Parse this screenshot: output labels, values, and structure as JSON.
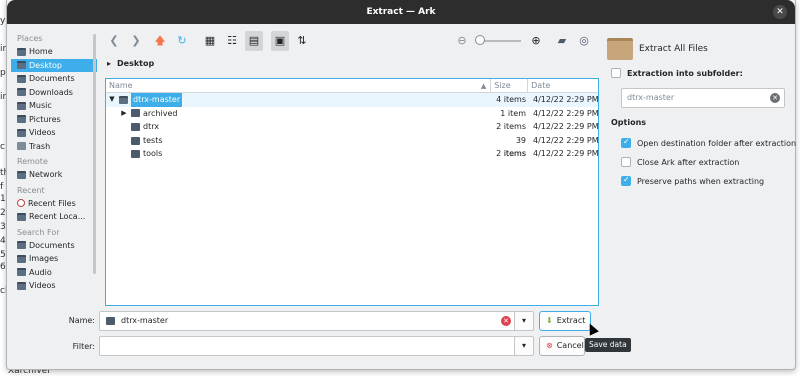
{
  "window": {
    "title": "Extract — Ark"
  },
  "underlying": {
    "left_fragments": [
      "y",
      "in",
      "p",
      "in",
      "c",
      "th",
      "f",
      "1",
      "2",
      "3",
      "4",
      "5",
      "6",
      "ck"
    ],
    "bottom_text": "Xarchiver"
  },
  "sidebar": {
    "sections": [
      {
        "heading": "Places",
        "items": [
          {
            "label": "Home",
            "icon": "home-folder-icon"
          },
          {
            "label": "Desktop",
            "icon": "desktop-folder-icon",
            "selected": true
          },
          {
            "label": "Documents",
            "icon": "documents-folder-icon"
          },
          {
            "label": "Downloads",
            "icon": "downloads-folder-icon"
          },
          {
            "label": "Music",
            "icon": "music-folder-icon"
          },
          {
            "label": "Pictures",
            "icon": "pictures-folder-icon"
          },
          {
            "label": "Videos",
            "icon": "videos-folder-icon"
          },
          {
            "label": "Trash",
            "icon": "trash-icon"
          }
        ]
      },
      {
        "heading": "Remote",
        "items": [
          {
            "label": "Network",
            "icon": "network-folder-icon"
          }
        ]
      },
      {
        "heading": "Recent",
        "items": [
          {
            "label": "Recent Files",
            "icon": "recent-files-icon"
          },
          {
            "label": "Recent Loca...",
            "icon": "recent-locations-icon"
          }
        ]
      },
      {
        "heading": "Search For",
        "items": [
          {
            "label": "Documents",
            "icon": "documents-folder-icon"
          },
          {
            "label": "Images",
            "icon": "images-folder-icon"
          },
          {
            "label": "Audio",
            "icon": "audio-folder-icon"
          },
          {
            "label": "Videos",
            "icon": "videos-folder-icon"
          }
        ]
      }
    ]
  },
  "toolbar": {
    "icons": [
      "back-icon",
      "forward-icon",
      "up-icon",
      "reload-icon",
      "icon-view-icon",
      "compact-view-icon",
      "detailed-view-icon",
      "preview-icon",
      "sort-icon",
      "zoom-out-icon",
      "zoom-in-icon",
      "new-folder-icon",
      "options-icon"
    ]
  },
  "breadcrumb": {
    "label": "Desktop"
  },
  "fileview": {
    "columns": [
      "Name",
      "Size",
      "Date"
    ],
    "rows": [
      {
        "name": "dtrx-master",
        "size": "4 items",
        "date": "4/12/22 2:29 PM",
        "expander": "▼",
        "selected": true,
        "indent": 0
      },
      {
        "name": "archived",
        "size": "1 item",
        "date": "4/12/22 2:29 PM",
        "expander": "▶",
        "indent": 1
      },
      {
        "name": "dtrx",
        "size": "2 items",
        "date": "4/12/22 2:29 PM",
        "expander": "",
        "indent": 1
      },
      {
        "name": "tests",
        "size": "39 items",
        "date": "4/12/22 2:29 PM",
        "expander": "",
        "indent": 1
      },
      {
        "name": "tools",
        "size": "2 items",
        "date": "4/12/22 2:29 PM",
        "expander": "",
        "indent": 1
      }
    ]
  },
  "right_panel": {
    "title": "Extract All Files",
    "subfolder_label": "Extraction into subfolder:",
    "subfolder_placeholder": "dtrx-master",
    "options_heading": "Options",
    "options": [
      {
        "label": "Open destination folder after extraction",
        "checked": true
      },
      {
        "label": "Close Ark after extraction",
        "checked": false
      },
      {
        "label": "Preserve paths when extracting",
        "checked": true
      }
    ]
  },
  "form": {
    "name_label": "Name:",
    "name_value": "dtrx-master",
    "filter_label": "Filter:",
    "filter_value": "",
    "extract_label": "Extract",
    "cancel_label": "Cancel",
    "tooltip": "Save data"
  }
}
